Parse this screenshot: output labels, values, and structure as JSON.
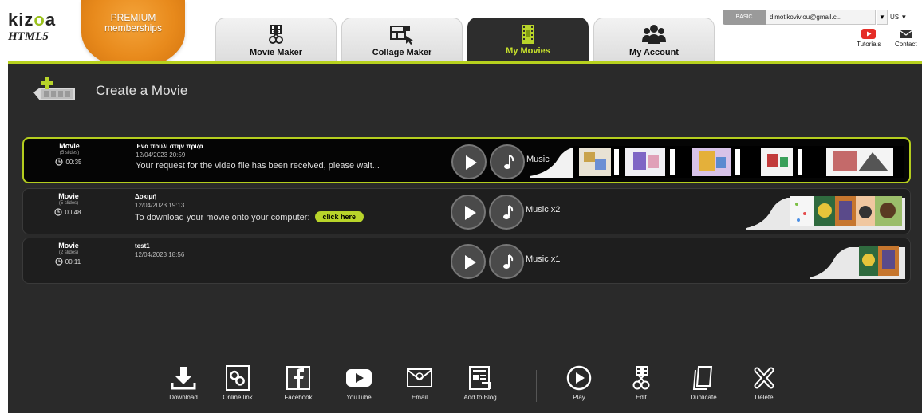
{
  "logo": {
    "word_prefix": "kiz",
    "word_dots": "o",
    "word_suffix": "a",
    "sub": "HTML5"
  },
  "premium": {
    "line1": "PREMIUM",
    "line2": "memberships"
  },
  "tabs": [
    {
      "label": "Movie Maker",
      "icon": "scissors-film-icon",
      "active": false
    },
    {
      "label": "Collage Maker",
      "icon": "collage-icon",
      "active": false
    },
    {
      "label": "My Movies",
      "icon": "film-frame-icon",
      "active": true
    },
    {
      "label": "My Account",
      "icon": "users-icon",
      "active": false
    }
  ],
  "account": {
    "plan": "BASIC",
    "email": "dimotikovivlou@gmail.c...",
    "caret": "▼",
    "lang": "US ▼"
  },
  "helpers": {
    "tutorials": "Tutorials",
    "contact": "Contact"
  },
  "create": {
    "label": "Create a Movie"
  },
  "movies": [
    {
      "kind": "Movie",
      "slides": "(5 slides)",
      "duration": "00:35",
      "title": "Ένα πουλί στην πρίζα",
      "date": "12/04/2023 20:59",
      "message": "Your request for the video file has been received, please wait...",
      "music": "Music",
      "selected": true,
      "link": ""
    },
    {
      "kind": "Movie",
      "slides": "(5 slides)",
      "duration": "00:48",
      "title": "Δοκιμή",
      "date": "12/04/2023 19:13",
      "message": "To download your movie onto your computer:",
      "music": "Music x2",
      "selected": false,
      "link": "click here"
    },
    {
      "kind": "Movie",
      "slides": "(2 slides)",
      "duration": "00:11",
      "title": "test1",
      "date": "12/04/2023 18:56",
      "message": "",
      "music": "Music x1",
      "selected": false,
      "link": ""
    }
  ],
  "toolbar": {
    "download": "Download",
    "online_link": "Online link",
    "facebook": "Facebook",
    "youtube": "YouTube",
    "email": "Email",
    "add_to_blog": "Add to Blog",
    "play": "Play",
    "edit": "Edit",
    "duplicate": "Duplicate",
    "delete": "Delete"
  },
  "colors": {
    "accent": "#b7d11e",
    "panel": "#2a2a2a",
    "premium": "#e88a1c"
  }
}
